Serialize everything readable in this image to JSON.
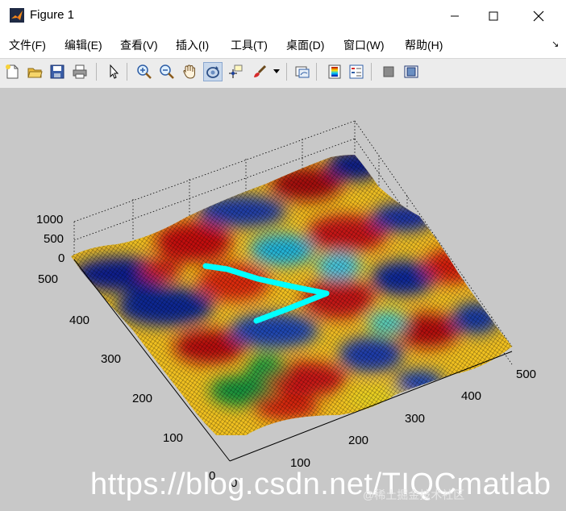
{
  "window": {
    "title": "Figure 1",
    "controls": [
      "minimize",
      "maximize",
      "close"
    ]
  },
  "menu": {
    "items": [
      {
        "label": "文件(F)"
      },
      {
        "label": "编辑(E)"
      },
      {
        "label": "查看(V)"
      },
      {
        "label": "插入(I)"
      },
      {
        "label": "工具(T)"
      },
      {
        "label": "桌面(D)"
      },
      {
        "label": "窗口(W)"
      },
      {
        "label": "帮助(H)"
      }
    ]
  },
  "toolbar": {
    "buttons": [
      {
        "icon": "new-figure-icon"
      },
      {
        "icon": "open-file-icon"
      },
      {
        "icon": "save-icon"
      },
      {
        "icon": "print-icon"
      },
      {
        "icon": "edit-plot-arrow-icon"
      },
      {
        "icon": "zoom-in-icon"
      },
      {
        "icon": "zoom-out-icon"
      },
      {
        "icon": "pan-hand-icon"
      },
      {
        "icon": "rotate-3d-icon",
        "active": true
      },
      {
        "icon": "data-cursor-icon"
      },
      {
        "icon": "brush-icon"
      },
      {
        "icon": "link-plot-icon"
      },
      {
        "icon": "colorbar-icon"
      },
      {
        "icon": "legend-icon"
      },
      {
        "icon": "hide-plot-tools-icon"
      },
      {
        "icon": "show-plot-tools-icon"
      }
    ]
  },
  "axes": {
    "z_ticks": [
      "1000",
      "500",
      "0"
    ],
    "y_ticks": [
      "500",
      "400",
      "300",
      "200",
      "100",
      "0"
    ],
    "x_ticks": [
      "0",
      "100",
      "200",
      "300",
      "400",
      "500"
    ],
    "background": "#c8c8c8",
    "path_color": "#00ffff",
    "colormap": "jet"
  },
  "watermark": {
    "main": "https://blog.csdn.net/TIQCmatlab",
    "secondary": "@稀土掘金技术社区"
  }
}
